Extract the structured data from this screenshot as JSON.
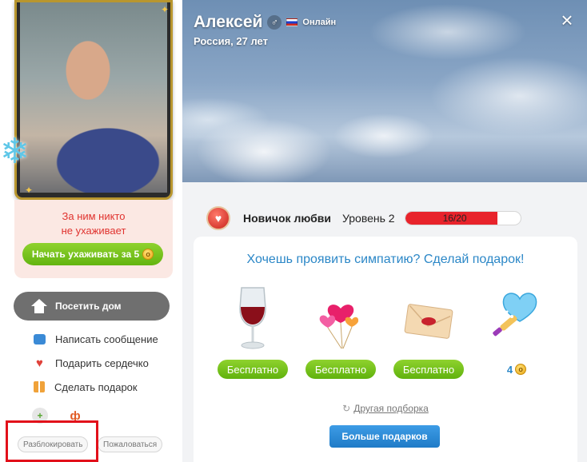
{
  "profile": {
    "name": "Алексей",
    "gender_icon": "male-symbol-icon",
    "gender_glyph": "♂",
    "flag": "russia-flag-icon",
    "status": "Онлайн",
    "subtitle": "Россия, 27 лет",
    "close_glyph": "×"
  },
  "care": {
    "text_line1": "За ним никто",
    "text_line2": "не ухаживает",
    "button_label": "Начать ухаживать за 5",
    "coin_glyph": "o"
  },
  "actions": {
    "visit_home": "Посетить дом",
    "items": [
      {
        "label": "Написать сообщение",
        "icon": "message-icon"
      },
      {
        "label": "Подарить сердечко",
        "icon": "heart-icon"
      },
      {
        "label": "Сделать подарок",
        "icon": "gift-icon"
      }
    ],
    "heart_glyph": "♥",
    "extra_icon_a": "+",
    "extra_icon_b": "ф",
    "unblock": "Разблокировать",
    "report": "Пожаловаться"
  },
  "level": {
    "title": "Новичок любви",
    "level_label": "Уровень 2",
    "progress_text": "16/20",
    "progress_current": 16,
    "progress_max": 20,
    "heart_glyph": "♥"
  },
  "gifts": {
    "heading": "Хочешь проявить симпатию? Сделай подарок!",
    "items": [
      {
        "name": "wine-glass-icon",
        "price": "Бесплатно"
      },
      {
        "name": "heart-balloons-icon",
        "price": "Бесплатно"
      },
      {
        "name": "kiss-envelope-icon",
        "price": "Бесплатно"
      },
      {
        "name": "heart-champagne-icon",
        "price": "4"
      }
    ],
    "other_selection": "Другая подборка",
    "refresh_glyph": "↻",
    "more_button": "Больше подарков"
  },
  "colors": {
    "accent_green": "#63b410",
    "link_blue": "#2b87c7",
    "progress_red": "#e8232b",
    "highlight_red": "#e2101a"
  }
}
